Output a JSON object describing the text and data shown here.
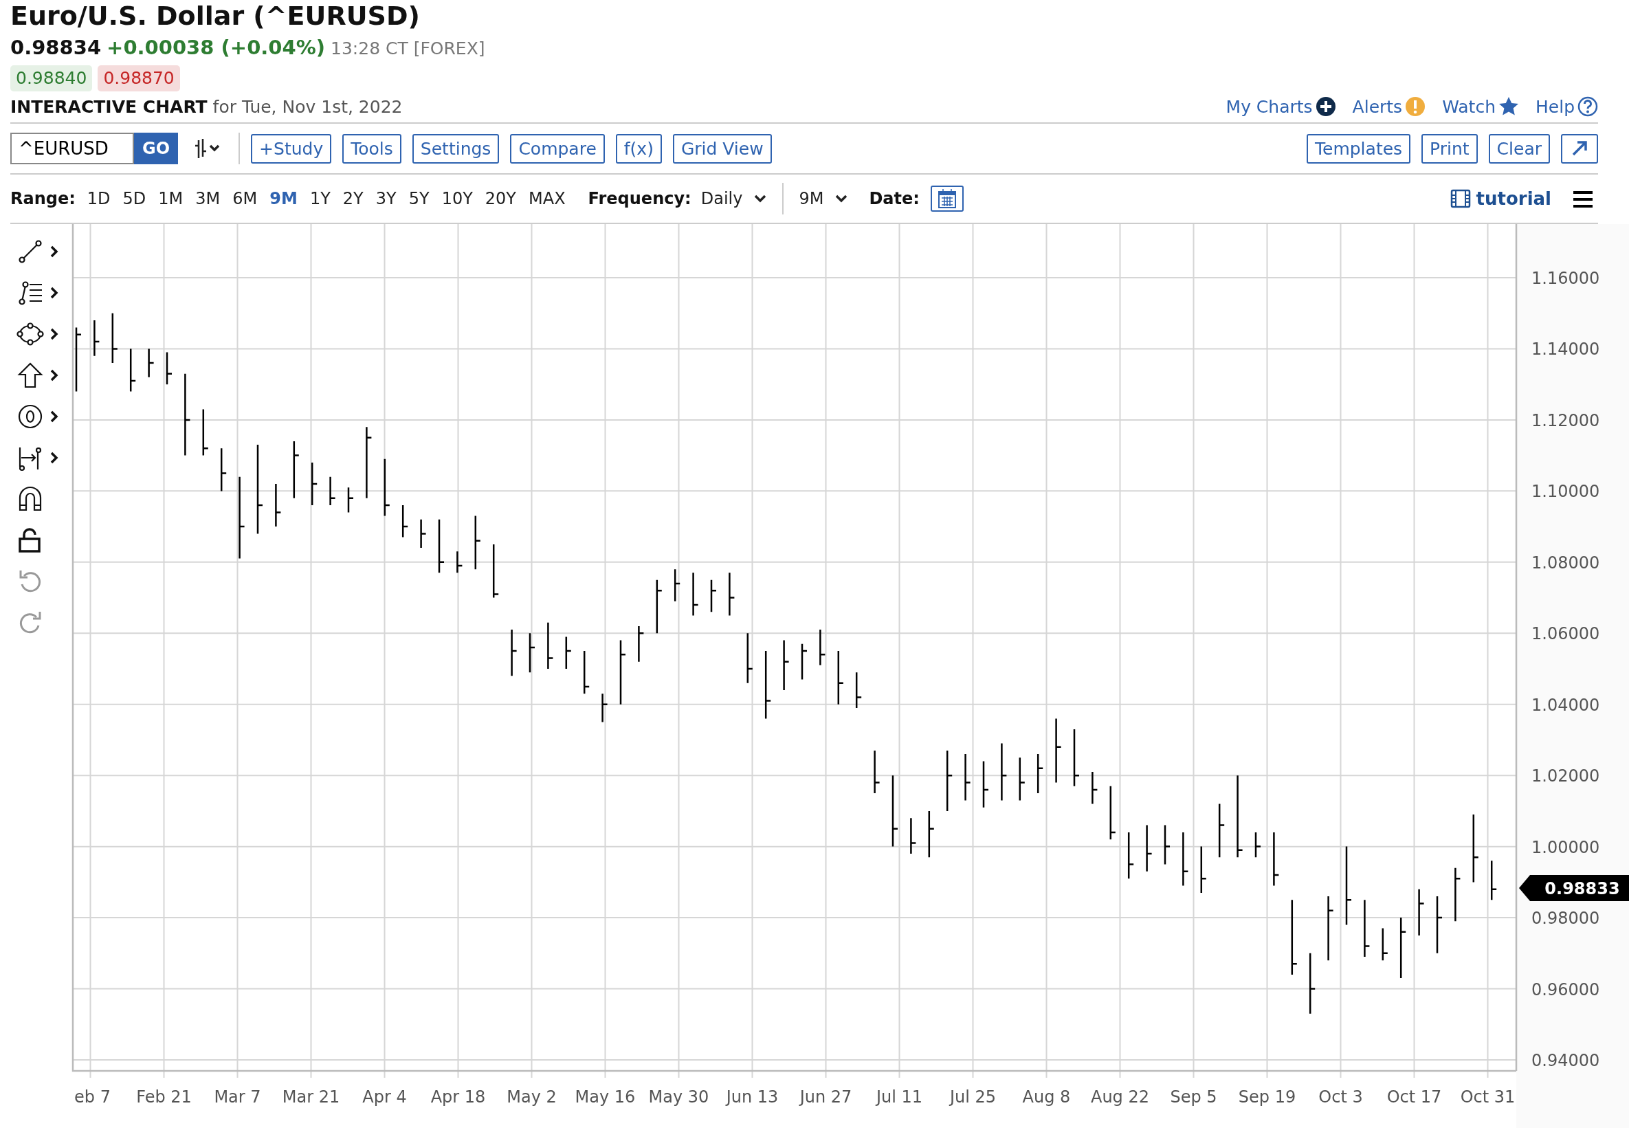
{
  "title": "Euro/U.S. Dollar (^EURUSD)",
  "quote": {
    "last": "0.98834",
    "change": "+0.00038 (+0.04%)",
    "time": "13:28 CT [FOREX]",
    "bid": "0.98840",
    "ask": "0.98870"
  },
  "chart_heading": {
    "label": "INTERACTIVE CHART",
    "date": "for Tue, Nov 1st, 2022"
  },
  "top_links": [
    {
      "label": "My Charts",
      "kind": "plus"
    },
    {
      "label": "Alerts",
      "kind": "alert"
    },
    {
      "label": "Watch",
      "kind": "star"
    },
    {
      "label": "Help",
      "kind": "help"
    }
  ],
  "symbol": {
    "value": "^EURUSD",
    "go": "GO"
  },
  "toolbar_buttons": [
    "+Study",
    "Tools",
    "Settings",
    "Compare",
    "f(x)",
    "Grid View"
  ],
  "right_buttons": [
    "Templates",
    "Print",
    "Clear"
  ],
  "range": {
    "label": "Range:",
    "options": [
      {
        "label": "1D",
        "selected": false
      },
      {
        "label": "5D",
        "selected": false
      },
      {
        "label": "1M",
        "selected": false
      },
      {
        "label": "3M",
        "selected": false
      },
      {
        "label": "6M",
        "selected": false
      },
      {
        "label": "9M",
        "selected": true
      },
      {
        "label": "1Y",
        "selected": false
      },
      {
        "label": "2Y",
        "selected": false
      },
      {
        "label": "3Y",
        "selected": false
      },
      {
        "label": "5Y",
        "selected": false
      },
      {
        "label": "10Y",
        "selected": false
      },
      {
        "label": "20Y",
        "selected": false
      },
      {
        "label": "MAX",
        "selected": false
      }
    ]
  },
  "frequency": {
    "label": "Frequency:",
    "value": "Daily"
  },
  "period": {
    "value": "9M"
  },
  "date": {
    "label": "Date:"
  },
  "tutorial": "tutorial",
  "tools": [
    {
      "kind": "line",
      "submenu": true,
      "disabled": false
    },
    {
      "kind": "fib",
      "submenu": true,
      "disabled": false
    },
    {
      "kind": "shape",
      "submenu": true,
      "disabled": false
    },
    {
      "kind": "arrow",
      "submenu": true,
      "disabled": false
    },
    {
      "kind": "marker",
      "submenu": true,
      "disabled": false
    },
    {
      "kind": "measure",
      "submenu": true,
      "disabled": false
    },
    {
      "kind": "magnet",
      "submenu": false,
      "disabled": false
    },
    {
      "kind": "lock",
      "submenu": false,
      "disabled": false
    },
    {
      "kind": "undo",
      "submenu": false,
      "disabled": true
    },
    {
      "kind": "redo",
      "submenu": false,
      "disabled": true
    }
  ],
  "chart": {
    "y_axis_labels": [
      "1.16000",
      "1.14000",
      "1.12000",
      "1.10000",
      "1.08000",
      "1.06000",
      "1.04000",
      "1.02000",
      "1.00000",
      "0.98000",
      "0.96000",
      "0.94000"
    ],
    "x_axis_labels": [
      "eb 7",
      "Feb 21",
      "Mar 7",
      "Mar 21",
      "Apr 4",
      "Apr 18",
      "May 2",
      "May 16",
      "May 30",
      "Jun 13",
      "Jun 27",
      "Jul 11",
      "Jul 25",
      "Aug 8",
      "Aug 22",
      "Sep 5",
      "Sep 19",
      "Oct 3",
      "Oct 17",
      "Oct 31"
    ],
    "last_price_tag": "0.98833"
  }
}
